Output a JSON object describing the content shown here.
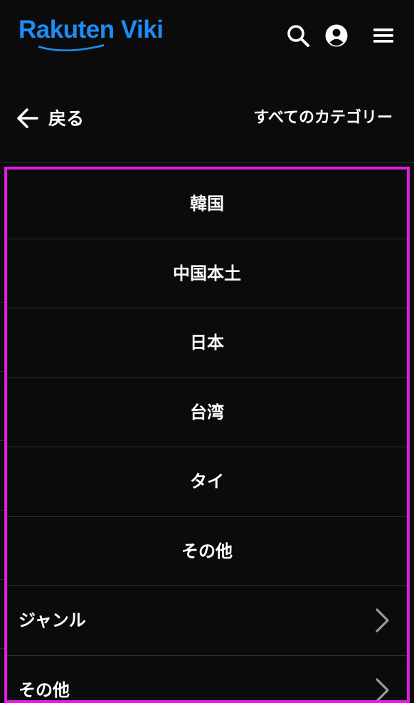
{
  "header": {
    "logo_text": "Rakuten Viki",
    "brand_color": "#1d8df2",
    "icons": [
      "search-icon",
      "account-icon",
      "menu-icon"
    ]
  },
  "subnav": {
    "back_label": "戻る",
    "all_categories_label": "すべてのカテゴリー"
  },
  "categories": {
    "items": [
      {
        "label": "韓国"
      },
      {
        "label": "中国本土"
      },
      {
        "label": "日本"
      },
      {
        "label": "台湾"
      },
      {
        "label": "タイ"
      },
      {
        "label": "その他"
      }
    ],
    "expandable": [
      {
        "label": "ジャンル",
        "icon": "chevron-right-icon"
      },
      {
        "label": "その他",
        "icon": "chevron-right-icon"
      }
    ]
  },
  "highlight_color": "#e21be2"
}
